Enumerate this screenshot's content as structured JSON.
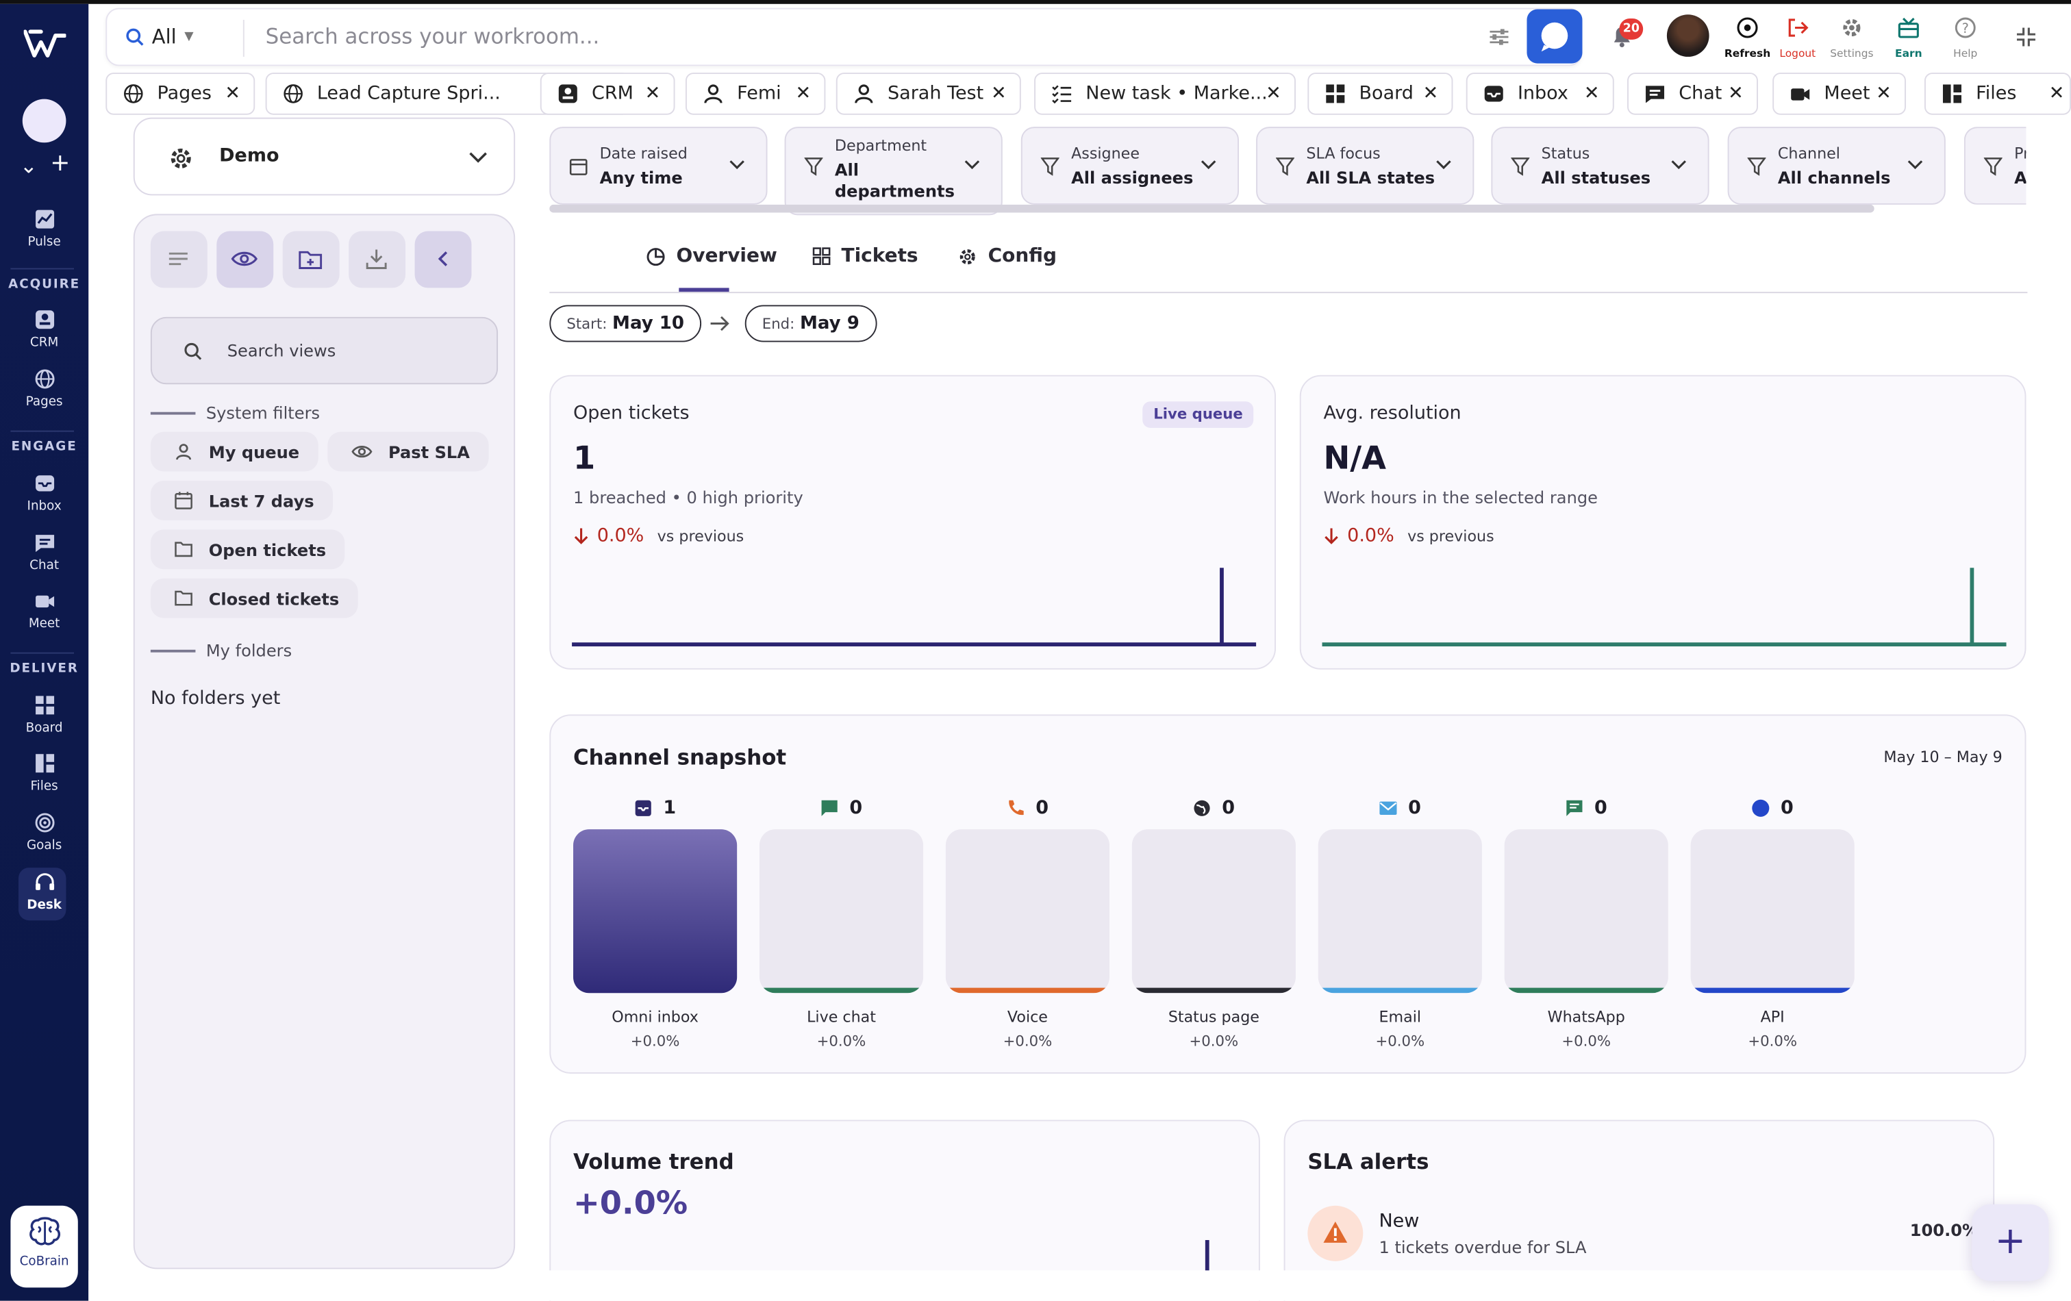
{
  "search": {
    "scope": "All",
    "placeholder": "Search across your workroom..."
  },
  "notifications": {
    "count": "20"
  },
  "top_actions": [
    {
      "label": "Refresh",
      "icon": "refresh-icon",
      "color": "#111111"
    },
    {
      "label": "Logout",
      "icon": "logout-icon",
      "color": "#d93025"
    },
    {
      "label": "Settings",
      "icon": "gear-icon",
      "color": "#888888"
    },
    {
      "label": "Earn",
      "icon": "gift-icon",
      "color": "#0f766e"
    },
    {
      "label": "Help",
      "icon": "help-icon",
      "color": "#888888"
    }
  ],
  "tabs": [
    {
      "label": "Pages"
    },
    {
      "label": "Lead Capture Spri..."
    },
    {
      "label": "CRM"
    },
    {
      "label": "Femi"
    },
    {
      "label": "Sarah Test"
    },
    {
      "label": "New task • Marke..."
    },
    {
      "label": "Board"
    },
    {
      "label": "Inbox"
    },
    {
      "label": "Chat"
    },
    {
      "label": "Meet"
    },
    {
      "label": "Files"
    }
  ],
  "rail": {
    "pulse": "Pulse",
    "acquire": "ACQUIRE",
    "crm": "CRM",
    "pages": "Pages",
    "engage": "ENGAGE",
    "inbox": "Inbox",
    "chat": "Chat",
    "meet": "Meet",
    "deliver": "DELIVER",
    "board": "Board",
    "files": "Files",
    "goals": "Goals",
    "desk": "Desk",
    "cobrain": "CoBrain"
  },
  "workspace": {
    "name": "Demo"
  },
  "views": {
    "search_placeholder": "Search views",
    "system_filters": "System filters",
    "my_queue": "My queue",
    "past_sla": "Past SLA",
    "last_7_days": "Last 7 days",
    "open_tickets": "Open tickets",
    "closed_tickets": "Closed tickets",
    "my_folders": "My folders",
    "no_folders": "No folders yet"
  },
  "filters": [
    {
      "label": "Date raised",
      "value": "Any time"
    },
    {
      "label": "Department",
      "value": "All departments"
    },
    {
      "label": "Assignee",
      "value": "All assignees"
    },
    {
      "label": "SLA focus",
      "value": "All SLA states"
    },
    {
      "label": "Status",
      "value": "All statuses"
    },
    {
      "label": "Channel",
      "value": "All channels"
    },
    {
      "label": "Pr",
      "value": "Al"
    }
  ],
  "main_tabs": {
    "overview": "Overview",
    "tickets": "Tickets",
    "config": "Config"
  },
  "date_range": {
    "start_label": "Start:",
    "start": "May 10",
    "end_label": "End:",
    "end": "May 9"
  },
  "open_tickets": {
    "title": "Open tickets",
    "badge": "Live queue",
    "value": "1",
    "sub": "1 breached • 0 high priority",
    "delta": "0.0%",
    "vs": "vs previous"
  },
  "avg_resolution": {
    "title": "Avg. resolution",
    "value": "N/A",
    "sub": "Work hours in the selected range",
    "delta": "0.0%",
    "vs": "vs previous"
  },
  "channel_snapshot": {
    "title": "Channel snapshot",
    "range": "May 10 – May 9",
    "channels": [
      {
        "name": "Omni inbox",
        "count": "1",
        "pct": "+0.0%",
        "color": "#2f2a6b",
        "icon": "inbox-icon"
      },
      {
        "name": "Live chat",
        "count": "0",
        "pct": "+0.0%",
        "color": "#2f7d5b",
        "icon": "chat-icon"
      },
      {
        "name": "Voice",
        "count": "0",
        "pct": "+0.0%",
        "color": "#e0692d",
        "icon": "phone-icon"
      },
      {
        "name": "Status page",
        "count": "0",
        "pct": "+0.0%",
        "color": "#2b2b33",
        "icon": "globe-icon"
      },
      {
        "name": "Email",
        "count": "0",
        "pct": "+0.0%",
        "color": "#4aa3df",
        "icon": "mail-icon"
      },
      {
        "name": "WhatsApp",
        "count": "0",
        "pct": "+0.0%",
        "color": "#2f7d5b",
        "icon": "message-icon"
      },
      {
        "name": "API",
        "count": "0",
        "pct": "+0.0%",
        "color": "#2447c9",
        "icon": "api-dot-icon"
      }
    ]
  },
  "volume_trend": {
    "title": "Volume trend",
    "value": "+0.0%"
  },
  "sla_alerts": {
    "title": "SLA alerts",
    "item_title": "New",
    "item_sub": "1 tickets overdue for SLA",
    "item_pct": "100.0%"
  },
  "colors": {
    "accent": "#4b3f96",
    "rail": "#0e1a4f",
    "negative": "#b3261e",
    "teal": "#2e7d6b"
  }
}
